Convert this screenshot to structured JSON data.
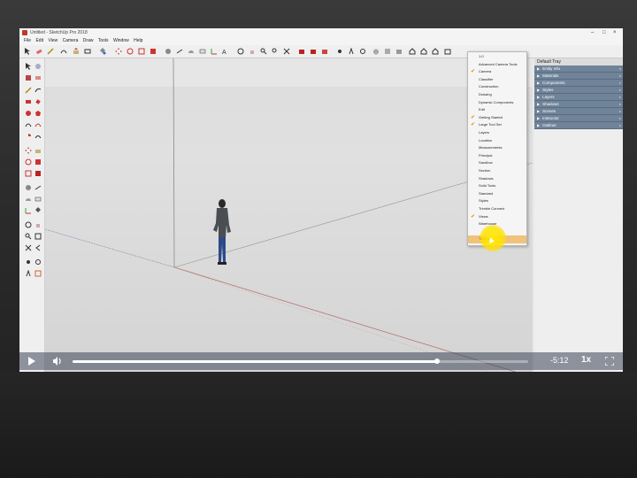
{
  "window": {
    "title": "Untitled - SketchUp Pro 2018",
    "controls": [
      "–",
      "□",
      "×"
    ]
  },
  "menubar": [
    "File",
    "Edit",
    "View",
    "Camera",
    "Draw",
    "Tools",
    "Window",
    "Help"
  ],
  "tray": {
    "header": "Default Tray",
    "panels": [
      "Entity Info",
      "Materials",
      "Components",
      "Styles",
      "Layers",
      "Shadows",
      "Scenes",
      "Instructor",
      "Outliner"
    ]
  },
  "toolbars_menu": {
    "items": [
      {
        "label": "1.0",
        "checked": false
      },
      {
        "label": "Advanced Camera Tools",
        "checked": false
      },
      {
        "label": "Camera",
        "checked": true
      },
      {
        "label": "Classifier",
        "checked": false
      },
      {
        "label": "Construction",
        "checked": false
      },
      {
        "label": "Drawing",
        "checked": false
      },
      {
        "label": "Dynamic Components",
        "checked": false
      },
      {
        "label": "Edit",
        "checked": false
      },
      {
        "label": "Getting Started",
        "checked": true
      },
      {
        "label": "Large Tool Set",
        "checked": true
      },
      {
        "label": "Layers",
        "checked": false
      },
      {
        "label": "Location",
        "checked": false
      },
      {
        "label": "Measurements",
        "checked": false
      },
      {
        "label": "Principal",
        "checked": false
      },
      {
        "label": "Sandbox",
        "checked": false
      },
      {
        "label": "Section",
        "checked": false
      },
      {
        "label": "Shadows",
        "checked": false
      },
      {
        "label": "Solid Tools",
        "checked": false
      },
      {
        "label": "Standard",
        "checked": false
      },
      {
        "label": "Styles",
        "checked": false
      },
      {
        "label": "Trimble Connect",
        "checked": false
      },
      {
        "label": "Views",
        "checked": true
      },
      {
        "label": "Warehouse",
        "checked": false
      },
      {
        "label": "",
        "checked": false
      },
      {
        "label": "Toolbars...",
        "checked": false
      }
    ],
    "check_color": "#e58a00",
    "highlight_color": "#f1c27a"
  },
  "player": {
    "time_remaining": "-5:12",
    "speed": "1x",
    "progress": 0.8
  },
  "colors": {
    "tray_panel": "#6f8399",
    "viewport": "#dcdcdc",
    "cursor_highlight": "#ffe600"
  },
  "icons": [
    "play-icon",
    "volume-icon",
    "fullscreen-icon",
    "select-arrow-icon",
    "eraser-icon",
    "pencil-icon",
    "paint-bucket-icon",
    "orbit-icon",
    "pan-icon",
    "zoom-icon",
    "zoom-extents-icon",
    "home-icon",
    "camera-icon"
  ]
}
